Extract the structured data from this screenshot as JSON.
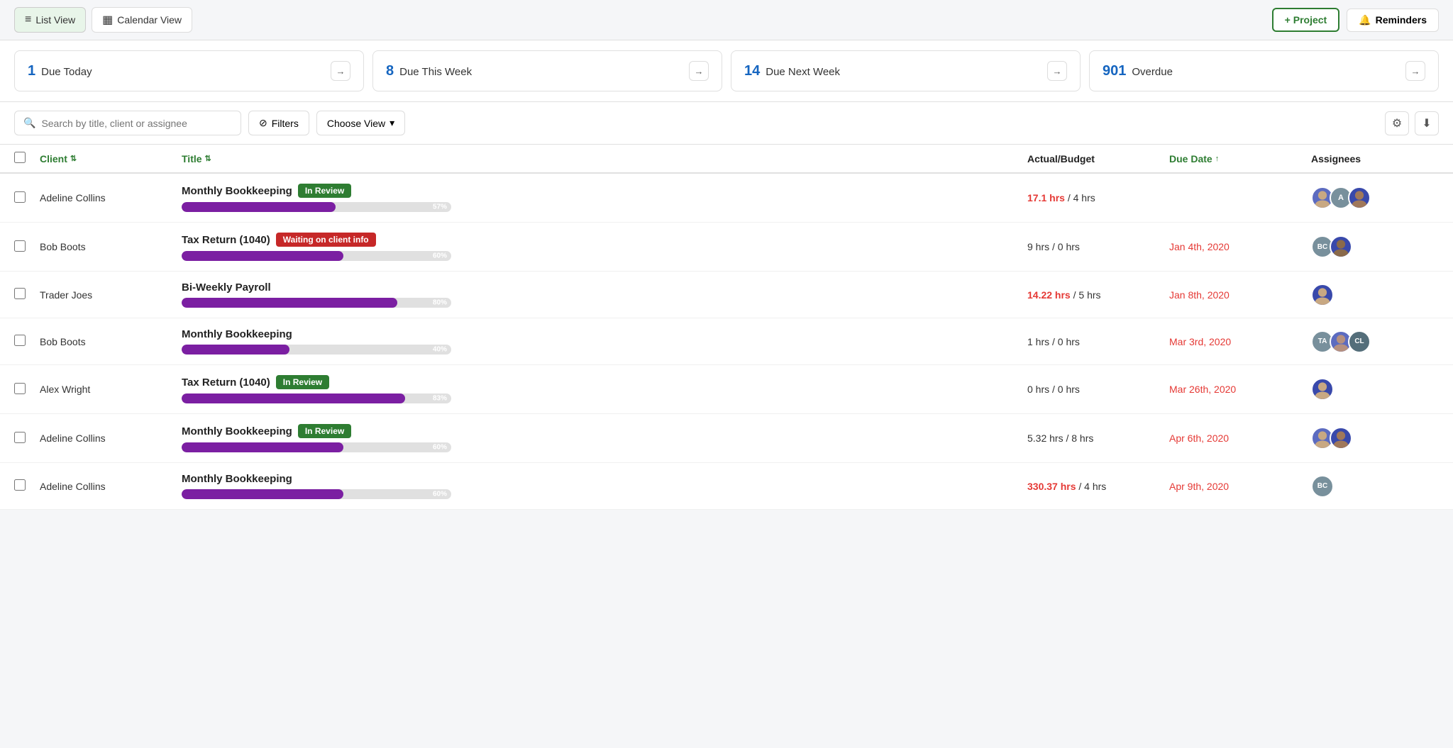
{
  "topbar": {
    "list_view_label": "List View",
    "calendar_view_label": "Calendar View",
    "project_btn_label": "+ Project",
    "reminders_btn_label": "Reminders"
  },
  "summary": {
    "cards": [
      {
        "count": "1",
        "label": "Due Today"
      },
      {
        "count": "8",
        "label": "Due This Week"
      },
      {
        "count": "14",
        "label": "Due Next Week"
      },
      {
        "count": "901",
        "label": "Overdue"
      }
    ]
  },
  "toolbar": {
    "search_placeholder": "Search by title, client or assignee",
    "filter_label": "Filters",
    "choose_view_label": "Choose View"
  },
  "table": {
    "headers": {
      "client": "Client",
      "title": "Title",
      "actual_budget": "Actual/Budget",
      "due_date": "Due Date",
      "assignees": "Assignees"
    },
    "rows": [
      {
        "client": "Adeline Collins",
        "title": "Monthly Bookkeeping",
        "badge": "In Review",
        "badge_type": "green",
        "progress": 57,
        "hours": "17.1 hrs",
        "budget": "4 hrs",
        "hours_over": true,
        "due_date": "",
        "date_red": false
      },
      {
        "client": "Bob Boots",
        "title": "Tax Return (1040)",
        "badge": "Waiting on client info",
        "badge_type": "red",
        "progress": 60,
        "hours": "9 hrs",
        "budget": "0 hrs",
        "hours_over": false,
        "due_date": "Jan 4th, 2020",
        "date_red": true
      },
      {
        "client": "Trader Joes",
        "title": "Bi-Weekly Payroll",
        "badge": "",
        "badge_type": "",
        "progress": 80,
        "hours": "14.22 hrs",
        "budget": "5 hrs",
        "hours_over": true,
        "due_date": "Jan 8th, 2020",
        "date_red": true
      },
      {
        "client": "Bob Boots",
        "title": "Monthly Bookkeeping",
        "badge": "",
        "badge_type": "",
        "progress": 40,
        "hours": "1 hrs",
        "budget": "0 hrs",
        "hours_over": false,
        "due_date": "Mar 3rd, 2020",
        "date_red": true
      },
      {
        "client": "Alex Wright",
        "title": "Tax Return (1040)",
        "badge": "In Review",
        "badge_type": "green",
        "progress": 83,
        "hours": "0 hrs",
        "budget": "0 hrs",
        "hours_over": false,
        "due_date": "Mar 26th, 2020",
        "date_red": true
      },
      {
        "client": "Adeline Collins",
        "title": "Monthly Bookkeeping",
        "badge": "In Review",
        "badge_type": "green",
        "progress": 60,
        "hours": "5.32 hrs",
        "budget": "8 hrs",
        "hours_over": false,
        "due_date": "Apr 6th, 2020",
        "date_red": true
      },
      {
        "client": "Adeline Collins",
        "title": "Monthly Bookkeeping",
        "badge": "",
        "badge_type": "",
        "progress": 60,
        "hours": "330.37 hrs",
        "budget": "4 hrs",
        "hours_over": true,
        "due_date": "Apr 9th, 2020",
        "date_red": true
      }
    ]
  }
}
